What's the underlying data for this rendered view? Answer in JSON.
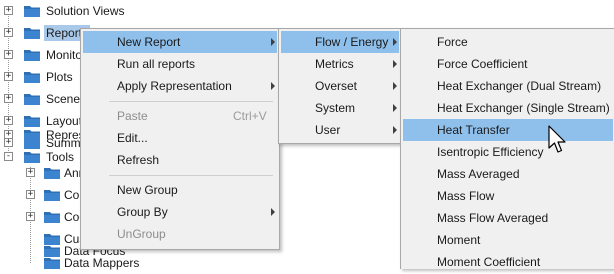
{
  "tree": {
    "items": [
      {
        "label": "Solution Views",
        "expand": "+"
      },
      {
        "label": "Reports",
        "expand": "+"
      },
      {
        "label": "Monitors",
        "expand": "+"
      },
      {
        "label": "Plots",
        "expand": "+"
      },
      {
        "label": "Scenes",
        "expand": "+"
      },
      {
        "label": "Layouts",
        "expand": "+"
      },
      {
        "label": "Summaries",
        "expand": "+"
      },
      {
        "label": "Representations",
        "expand": "+"
      },
      {
        "label": "Tools",
        "expand": "-"
      }
    ],
    "children": [
      {
        "label": "Annotations",
        "expand": "+"
      },
      {
        "label": "Colormaps",
        "expand": "+"
      },
      {
        "label": "Coordinate Systems",
        "expand": "+"
      },
      {
        "label": "Custom Colormaps",
        "expand": ""
      },
      {
        "label": "Data Focus",
        "expand": ""
      },
      {
        "label": "Data Mappers",
        "expand": ""
      }
    ]
  },
  "context_menu": {
    "items": [
      {
        "label": "New Report",
        "submenu": true
      },
      {
        "label": "Run all reports"
      },
      {
        "label": "Apply Representation",
        "submenu": true
      },
      {
        "label": "Paste",
        "shortcut": "Ctrl+V",
        "disabled": true
      },
      {
        "label": "Edit..."
      },
      {
        "label": "Refresh"
      },
      {
        "label": "New Group"
      },
      {
        "label": "Group By",
        "submenu": true
      },
      {
        "label": "UnGroup",
        "disabled": true
      }
    ]
  },
  "category_menu": {
    "items": [
      {
        "label": "Flow / Energy",
        "submenu": true
      },
      {
        "label": "Metrics",
        "submenu": true
      },
      {
        "label": "Overset",
        "submenu": true
      },
      {
        "label": "System",
        "submenu": true
      },
      {
        "label": "User",
        "submenu": true
      }
    ]
  },
  "report_menu": {
    "items": [
      {
        "label": "Force"
      },
      {
        "label": "Force Coefficient"
      },
      {
        "label": "Heat Exchanger (Dual Stream)"
      },
      {
        "label": "Heat Exchanger (Single Stream)"
      },
      {
        "label": "Heat Transfer"
      },
      {
        "label": "Isentropic Efficiency"
      },
      {
        "label": "Mass Averaged"
      },
      {
        "label": "Mass Flow"
      },
      {
        "label": "Mass Flow Averaged"
      },
      {
        "label": "Moment"
      },
      {
        "label": "Moment Coefficient"
      }
    ]
  },
  "colors": {
    "highlight": "#8fc0ec",
    "tree_selection": "#a9c9ea",
    "folder": "#2f6fb3",
    "menu_bg": "#f0f0f0"
  },
  "icons": {
    "folder": "folder-icon",
    "expand": "expand-toggle-icon",
    "submenu": "chevron-right-icon",
    "cursor": "mouse-pointer-icon"
  }
}
